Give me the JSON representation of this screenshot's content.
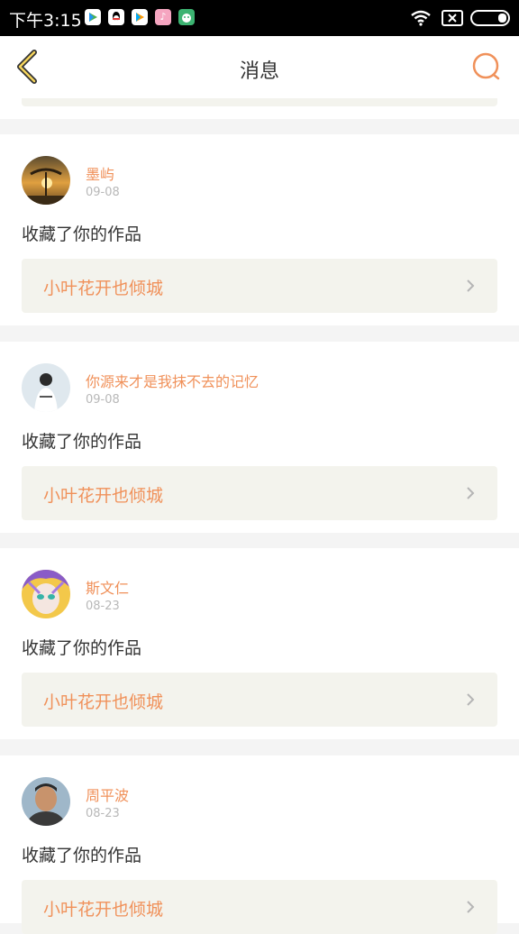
{
  "statusbar": {
    "time": "下午3:15",
    "apps": [
      {
        "icon": "play-store-icon",
        "bg": "#ffffff"
      },
      {
        "icon": "qq-icon",
        "bg": "#ffffff"
      },
      {
        "icon": "video-play-icon",
        "bg": "#ffffff"
      },
      {
        "icon": "music-app-icon",
        "bg": "#f5a5c0"
      },
      {
        "icon": "frog-app-icon",
        "bg": "#3cb371"
      }
    ]
  },
  "navbar": {
    "title": "消息",
    "accent": "#f0915a"
  },
  "messages": [
    {
      "username": "墨屿",
      "date": "09-08",
      "action": "收藏了你的作品",
      "work_title": "小叶花开也倾城",
      "avatar": "avatar-sunset-tree"
    },
    {
      "username": "你源来才是我抹不去的记忆",
      "date": "09-08",
      "action": "收藏了你的作品",
      "work_title": "小叶花开也倾城",
      "avatar": "avatar-white-shirt"
    },
    {
      "username": "斯文仁",
      "date": "08-23",
      "action": "收藏了你的作品",
      "work_title": "小叶花开也倾城",
      "avatar": "avatar-anime"
    },
    {
      "username": "周平波",
      "date": "08-23",
      "action": "收藏了你的作品",
      "work_title": "小叶花开也倾城",
      "avatar": "avatar-man-portrait"
    }
  ]
}
